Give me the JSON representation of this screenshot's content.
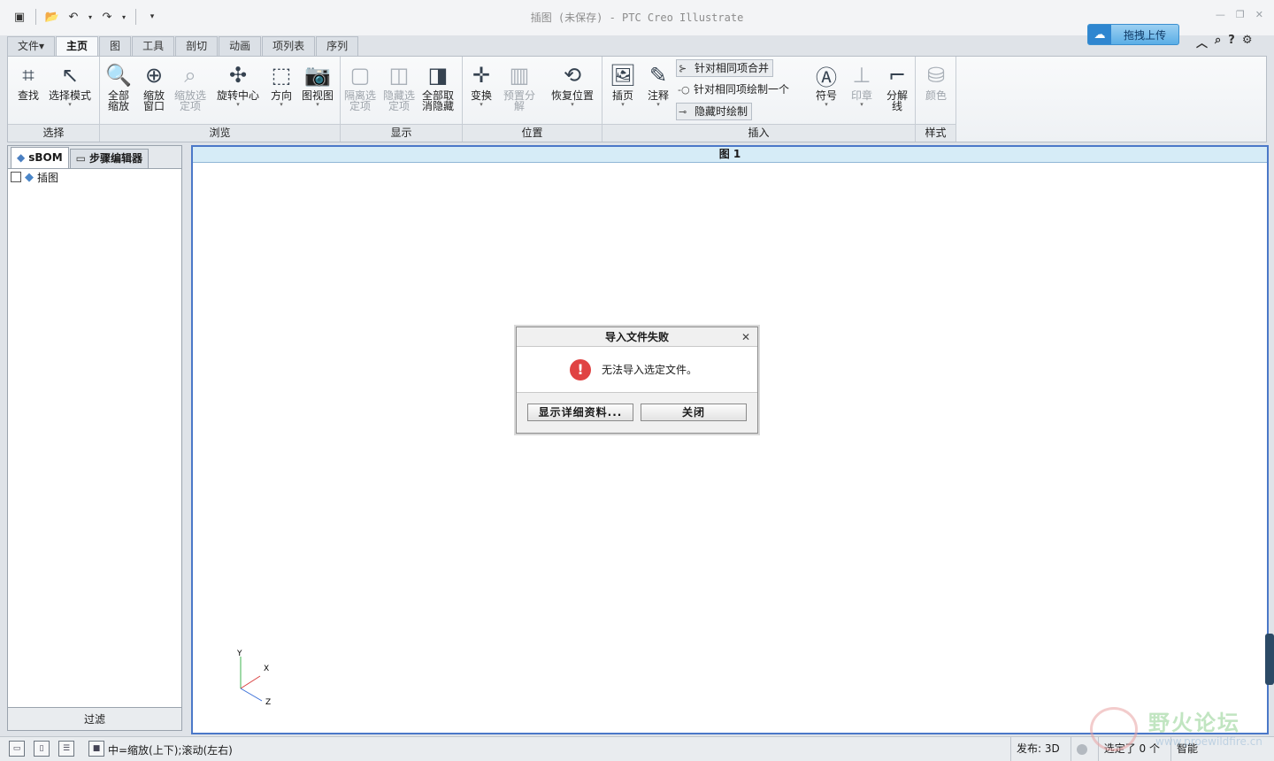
{
  "window": {
    "title": "插图 (未保存) - PTC Creo Illustrate",
    "upload_label": "拖拽上传"
  },
  "tabs": [
    "文件▾",
    "主页",
    "图",
    "工具",
    "剖切",
    "动画",
    "项列表",
    "序列"
  ],
  "ribbon": {
    "groups": {
      "select": "选择",
      "browse": "浏览",
      "display": "显示",
      "position": "位置",
      "insert": "插入",
      "style": "样式"
    },
    "buttons": {
      "find": "查找",
      "select_mode": "选择模式",
      "zoom_all": "全部\n缩放",
      "zoom_window": "缩放\n窗口",
      "zoom_selected": "缩放选\n定项",
      "spin_center": "旋转中心",
      "orientation": "方向",
      "view_image": "图视图",
      "isolate": "隔离选\n定项",
      "hide_selected": "隐藏选\n定项",
      "unhide_all": "全部取\n消隐藏",
      "transform": "变换",
      "pre_explode": "预置分\n解",
      "restore_position": "恢复位置",
      "insert_page": "插页",
      "annotation": "注释",
      "symbol": "符号",
      "stamp": "印章",
      "explode_line": "分解\n线",
      "color": "颜色"
    },
    "small_buttons": {
      "merge_same": "针对相同项合并",
      "draw_one_same": "针对相同项绘制一个",
      "draw_when_hidden": "隐藏时绘制"
    }
  },
  "left_panel": {
    "tabs": [
      "sBOM",
      "步骤编辑器"
    ],
    "tree": [
      {
        "label": "插图"
      }
    ],
    "filter_label": "过滤"
  },
  "canvas": {
    "header": "图 1",
    "axes": {
      "y": "Y",
      "x": "X",
      "z": "Z"
    }
  },
  "dialog": {
    "title": "导入文件失败",
    "message": "无法导入选定文件。",
    "details_button": "显示详细资料...",
    "close_button": "关闭"
  },
  "status": {
    "hint": "中=缩放(上下);滚动(左右)",
    "publish": "发布: 3D",
    "selected": "选定了 0 个",
    "filter_mode": "智能"
  },
  "watermark": {
    "text": "野火论坛",
    "url": "www.proewildfire.cn"
  }
}
